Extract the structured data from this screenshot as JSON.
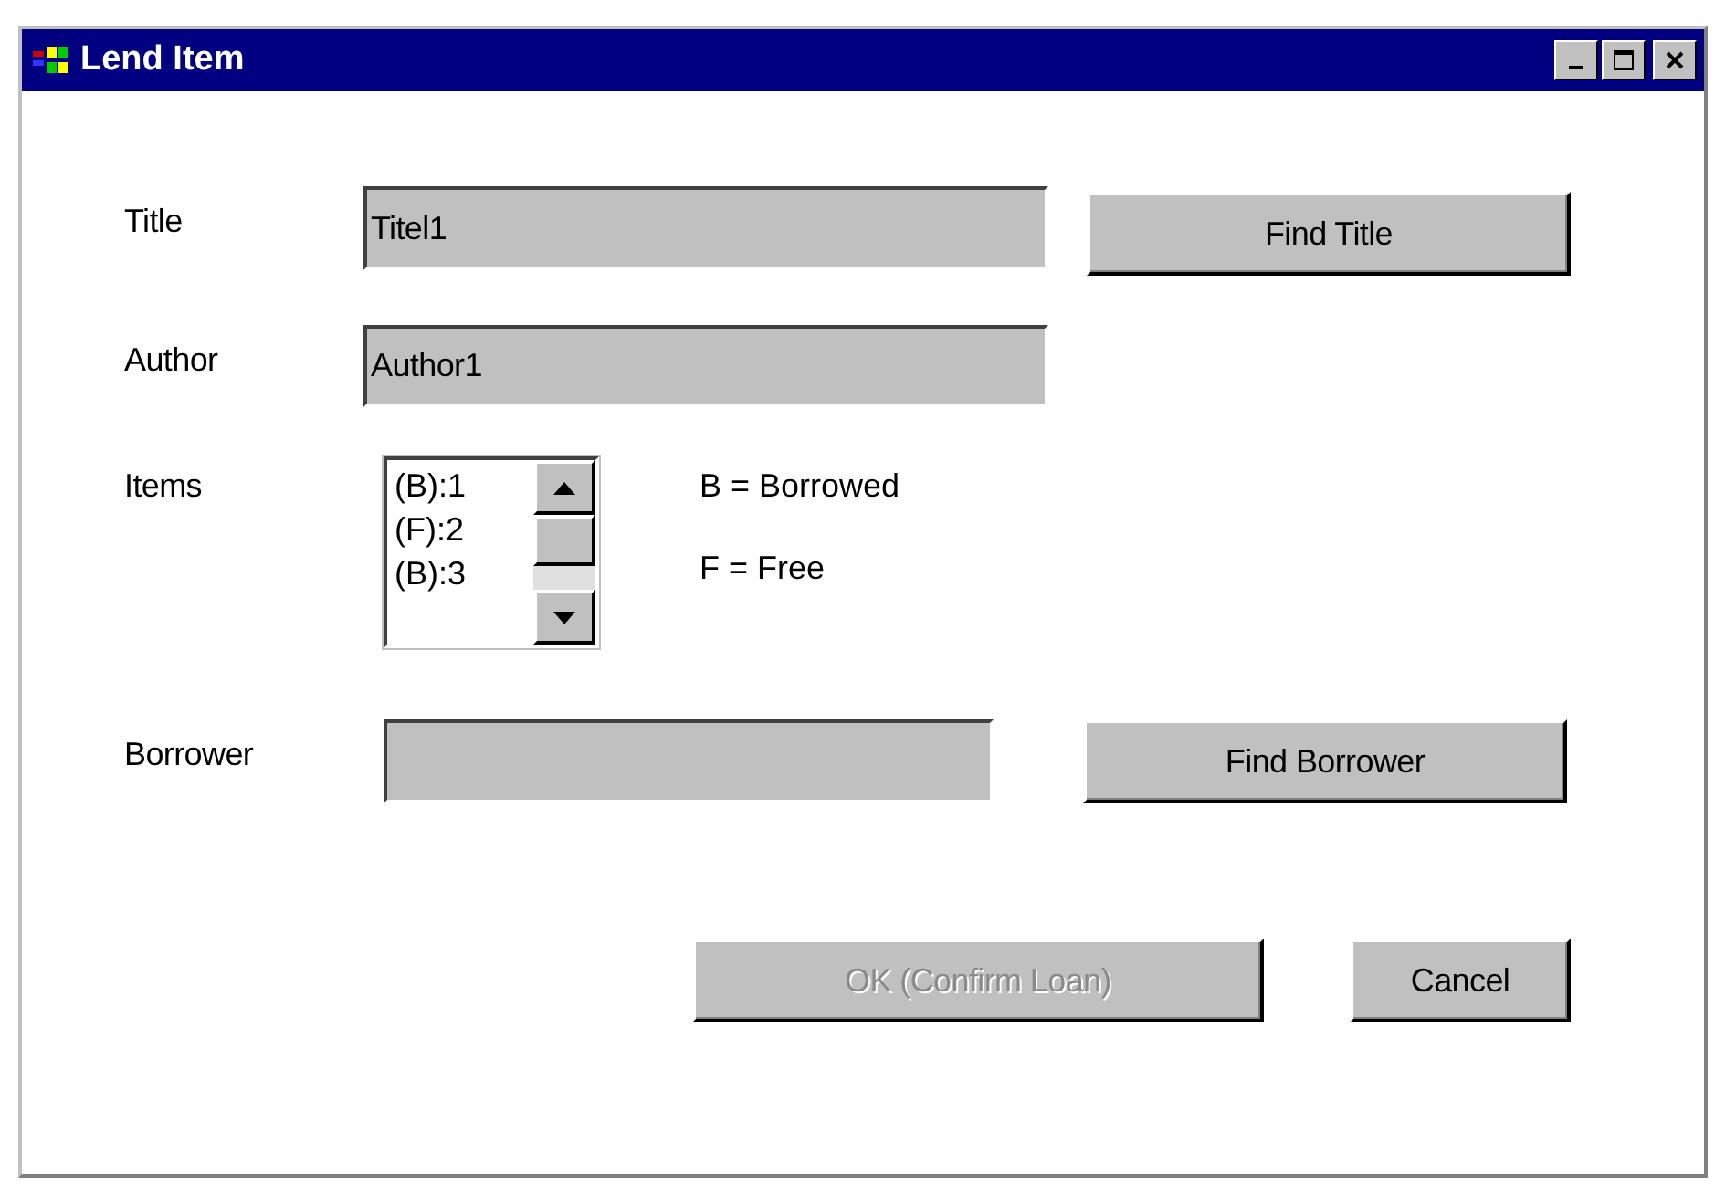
{
  "window": {
    "title": "Lend Item"
  },
  "title_field": {
    "label": "Title",
    "value": "Titel1",
    "button": {
      "label": "Find Title",
      "disabled": false
    }
  },
  "author_field": {
    "label": "Author",
    "value": "Author1"
  },
  "items": {
    "label": "Items",
    "options": [
      "(B):1",
      "(F):2",
      "(B):3"
    ],
    "legend": [
      "B = Borrowed",
      "F = Free"
    ]
  },
  "borrower_field": {
    "label": "Borrower",
    "button": {
      "label": "Find Borrower",
      "disabled": false
    }
  },
  "buttons": [
    {
      "label": "OK (Confirm Loan)",
      "disabled": true
    },
    {
      "label": "Cancel",
      "disabled": false
    }
  ]
}
